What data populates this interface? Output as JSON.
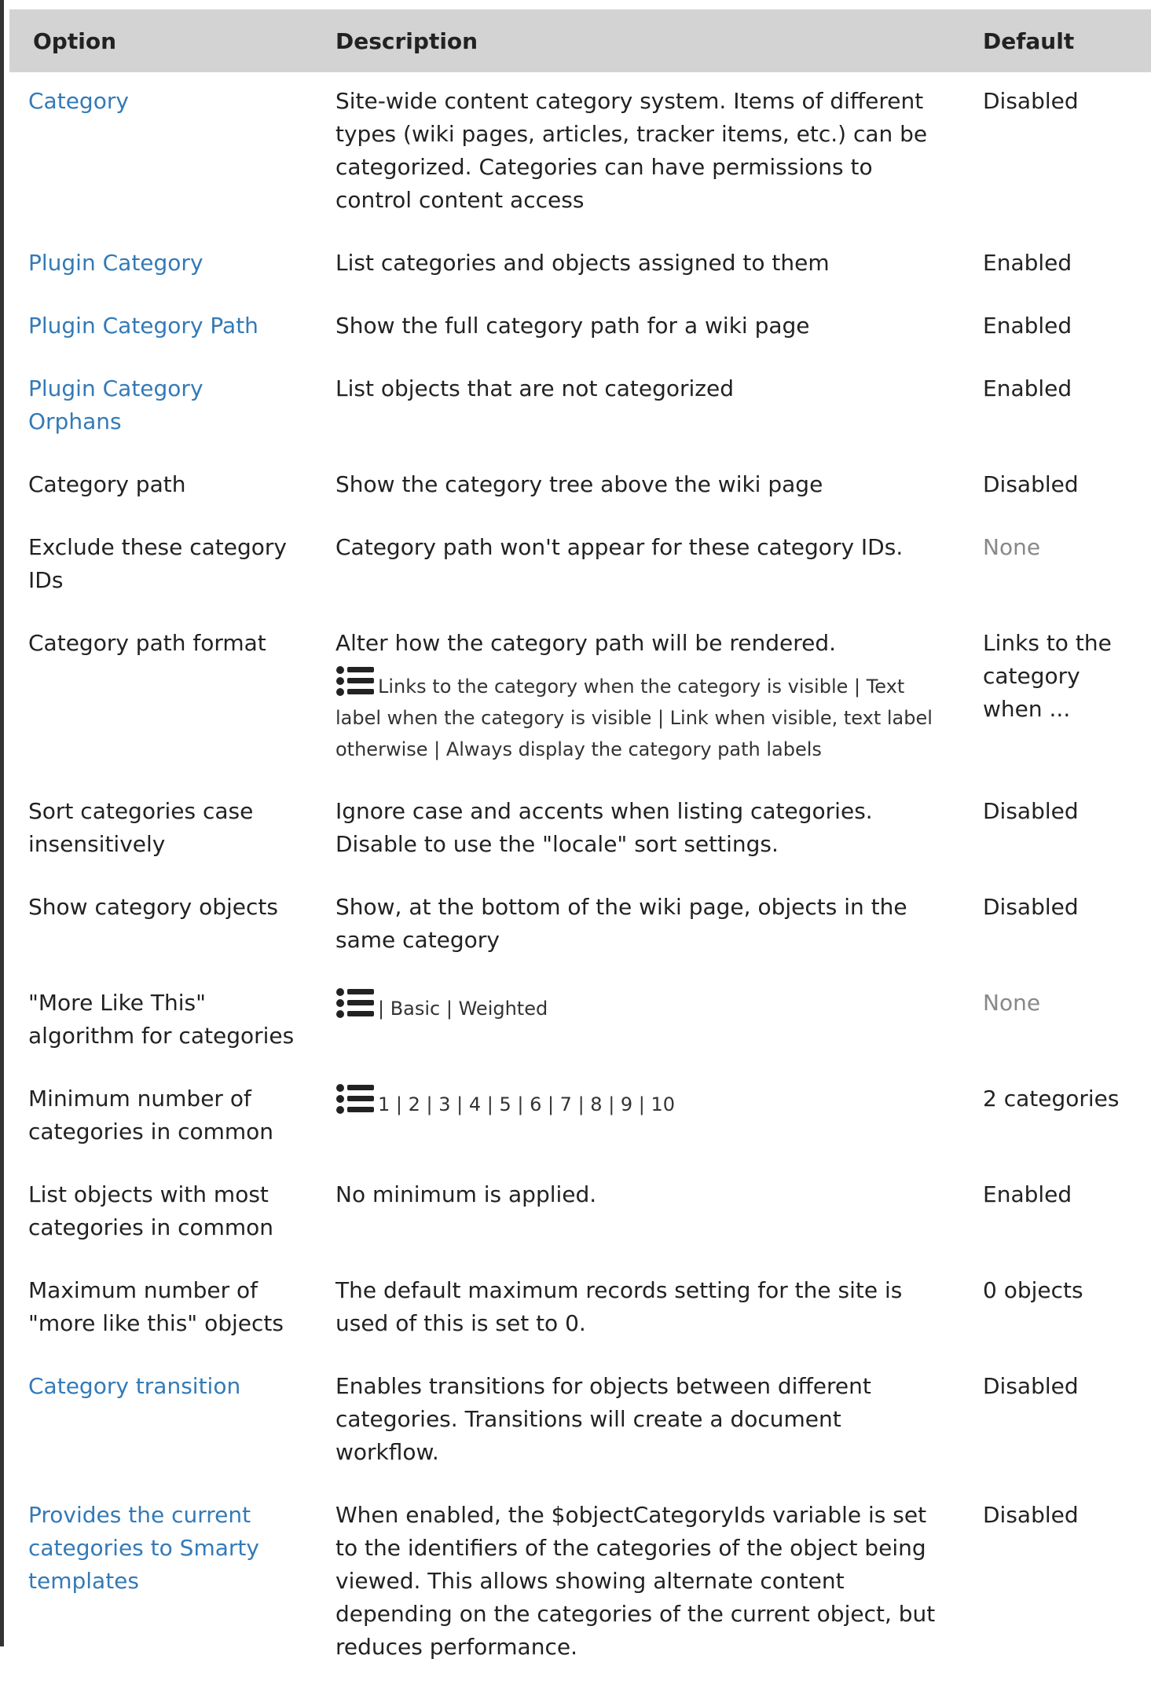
{
  "table": {
    "headers": {
      "option": "Option",
      "description": "Description",
      "default": "Default"
    },
    "rows": [
      {
        "option": "Category",
        "link": true,
        "description": "Site-wide content category system. Items of different types (wiki pages, articles, tracker items, etc.) can be categorized. Categories can have permissions to control content access",
        "default": "Disabled"
      },
      {
        "option": "Plugin Category",
        "link": true,
        "description": "List categories and objects assigned to them",
        "default": "Enabled"
      },
      {
        "option": "Plugin Category Path",
        "link": true,
        "description": "Show the full category path for a wiki page",
        "default": "Enabled"
      },
      {
        "option": "Plugin Category Orphans",
        "link": true,
        "description": "List objects that are not categorized",
        "default": "Enabled"
      },
      {
        "option": "Category path",
        "link": false,
        "description": "Show the category tree above the wiki page",
        "default": "Disabled"
      },
      {
        "option": "Exclude these category IDs",
        "link": false,
        "description": "Category path won't appear for these category IDs.",
        "default": "None",
        "default_muted": true
      },
      {
        "option": "Category path format",
        "link": false,
        "description": "Alter how the category path will be rendered.",
        "choices": "Links to the category when the category is visible | Text label when the category is visible | Link when visible, text label otherwise | Always display the category path labels",
        "default": "Links to the category when ..."
      },
      {
        "option": "Sort categories case insensitively",
        "link": false,
        "description": "Ignore case and accents when listing categories. Disable to use the \"locale\" sort settings.",
        "default": "Disabled"
      },
      {
        "option": "Show category objects",
        "link": false,
        "description": "Show, at the bottom of the wiki page, objects in the same category",
        "default": "Disabled"
      },
      {
        "option": "\"More Like This\" algorithm for categories",
        "link": false,
        "description": "",
        "choices": "| Basic | Weighted",
        "default": "None",
        "default_muted": true
      },
      {
        "option": "Minimum number of categories in common",
        "link": false,
        "description": "",
        "choices": "1 | 2 | 3 | 4 | 5 | 6 | 7 | 8 | 9 | 10",
        "default": "2 categories"
      },
      {
        "option": "List objects with most categories in common",
        "link": false,
        "description": "No minimum is applied.",
        "default": "Enabled"
      },
      {
        "option": "Maximum number of \"more like this\" objects",
        "link": false,
        "description": "The default maximum records setting for the site is used of this is set to 0.",
        "default": "0 objects"
      },
      {
        "option": "Category transition",
        "link": true,
        "description": "Enables transitions for objects between different categories. Transitions will create a document workflow.",
        "default": "Disabled"
      },
      {
        "option": "Provides the current categories to Smarty templates",
        "link": true,
        "description": "When enabled, the $objectCategoryIds variable is set to the identifiers of the categories of the object being viewed. This allows showing alternate content depending on the categories of the current object, but reduces performance.",
        "default": "Disabled"
      }
    ]
  },
  "colors": {
    "link": "#337ab7",
    "header_bg": "#d3d3d3",
    "muted": "#888888",
    "text": "#222222"
  },
  "icons": {
    "choices": "list-icon"
  }
}
